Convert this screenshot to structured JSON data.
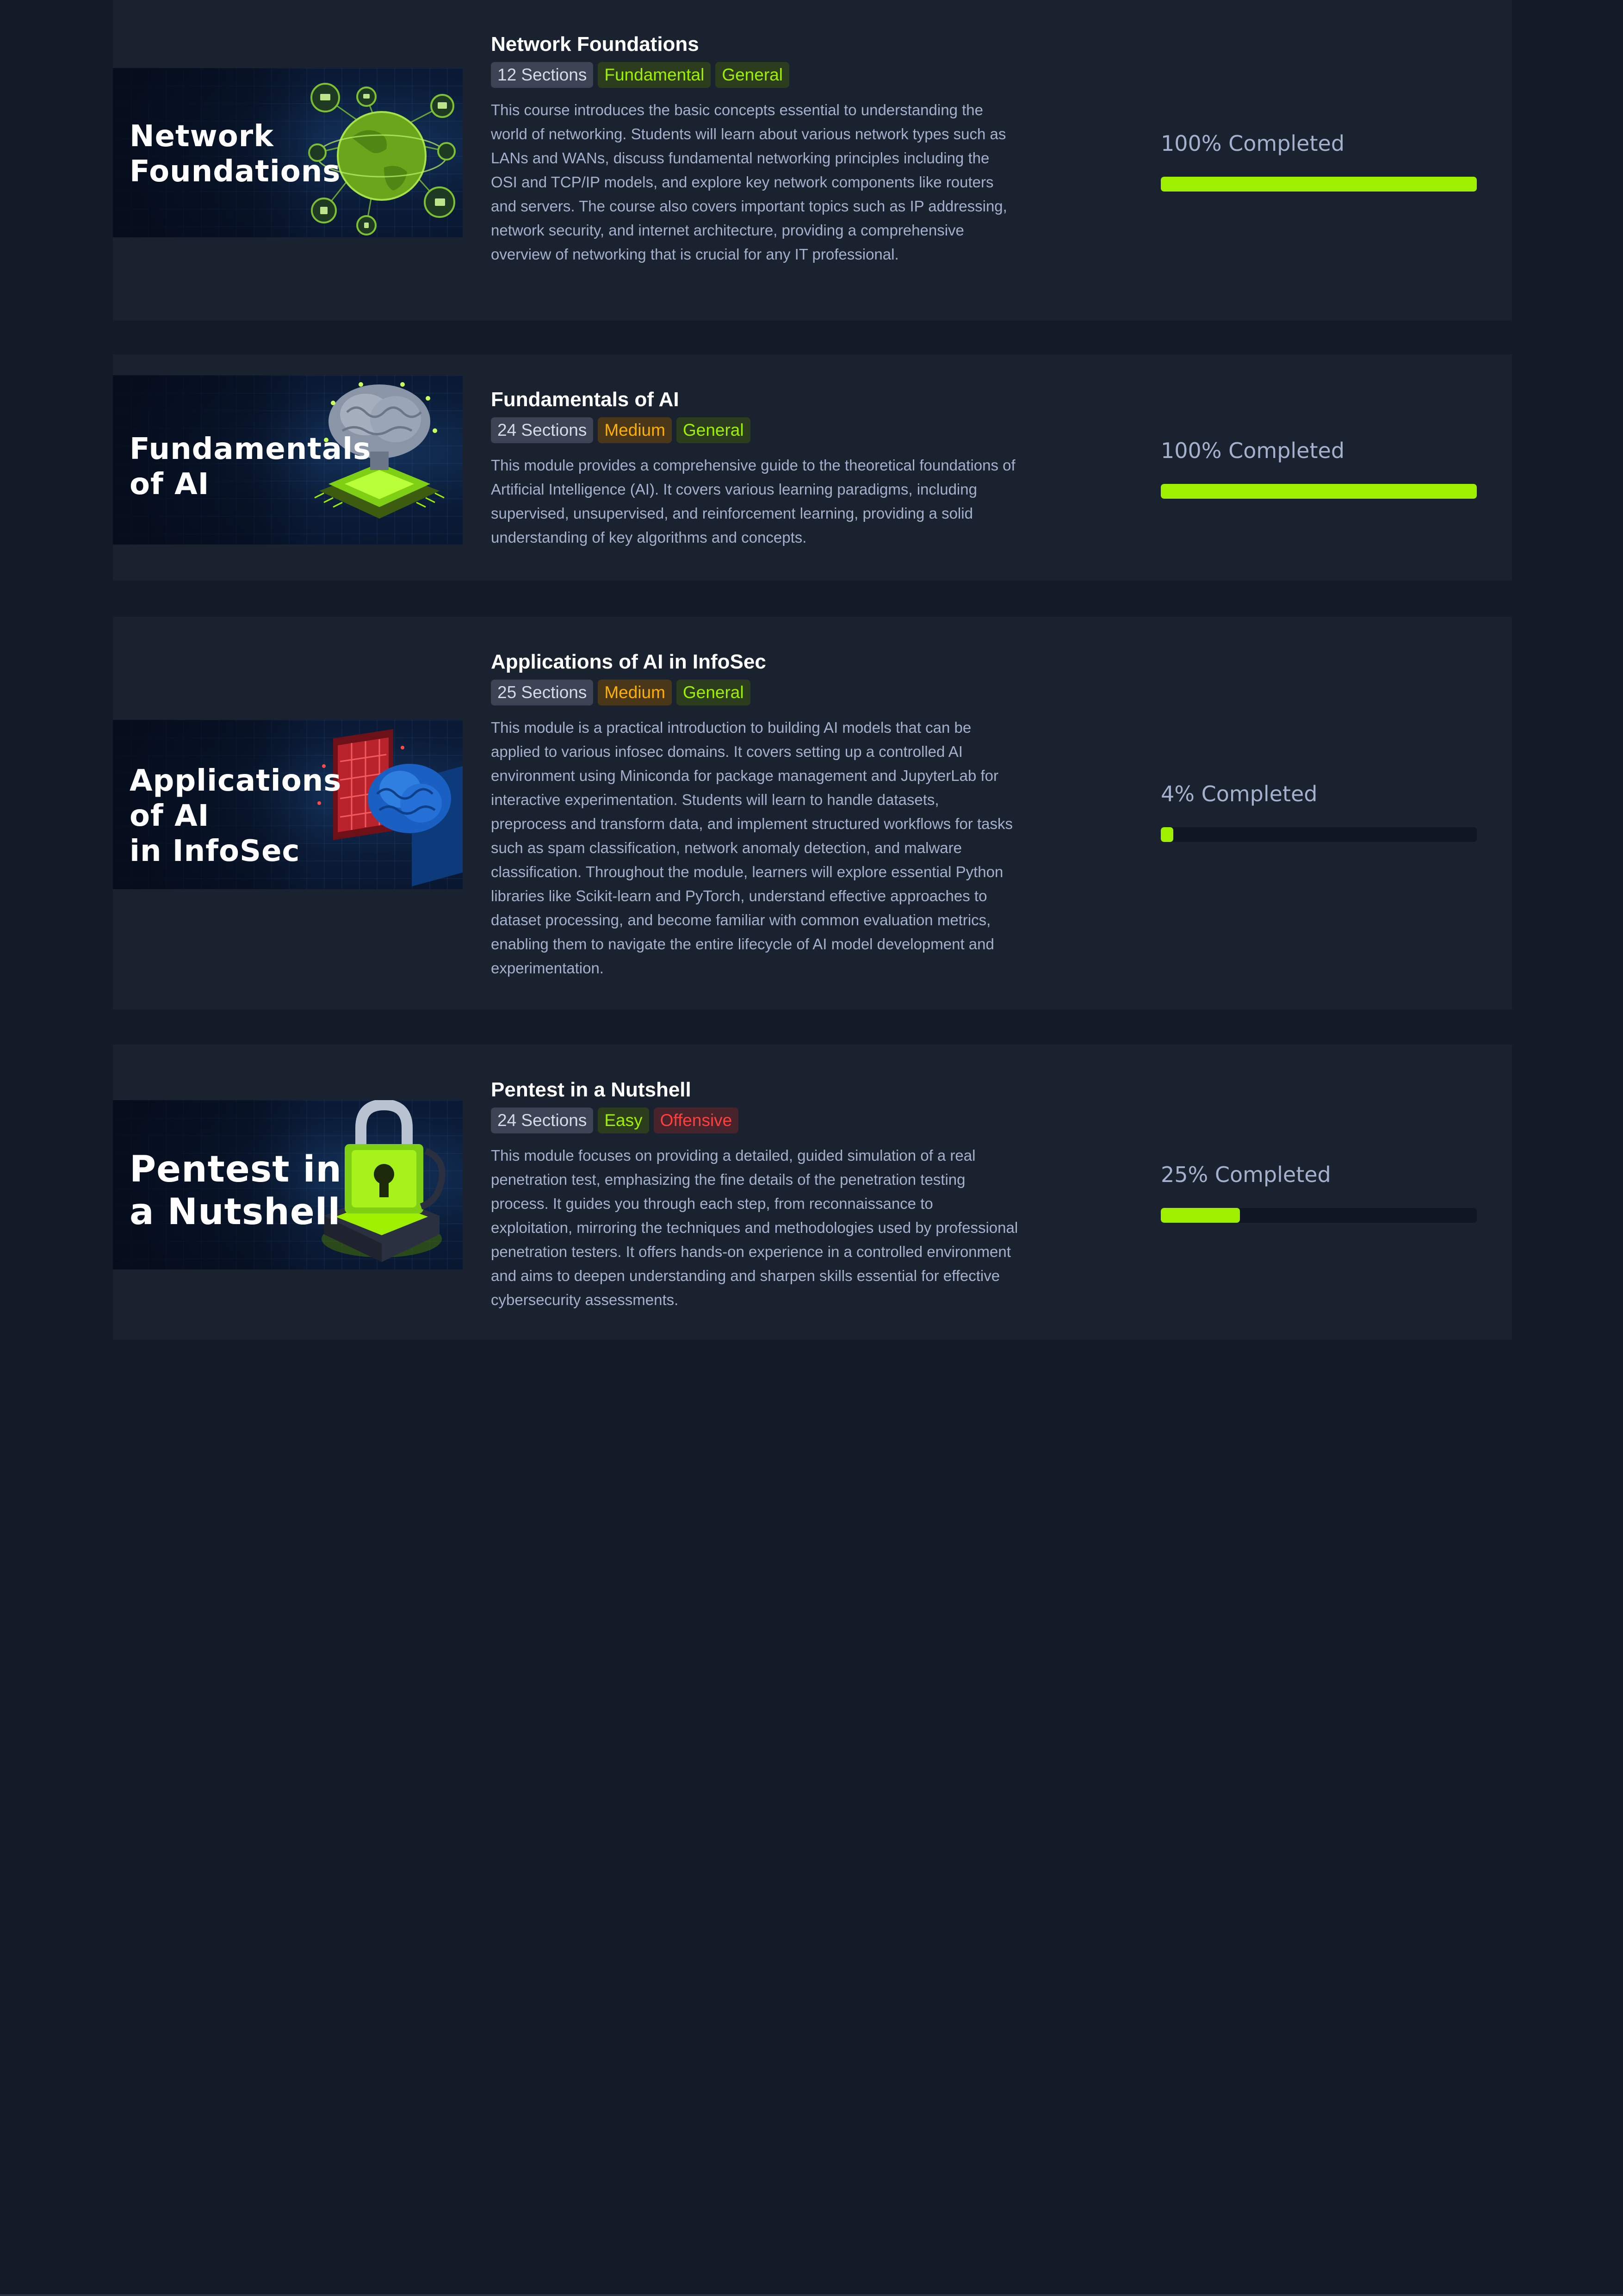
{
  "accent_color": "#9fef00",
  "courses": [
    {
      "thumbnail_title": "Network\nFoundations",
      "title": "Network Foundations",
      "tags": [
        "12 Sections",
        "Fundamental",
        "General"
      ],
      "description": "This course introduces the basic concepts essential to understanding the world of networking. Students will learn about various network types such as LANs and WANs, discuss fundamental networking principles including the OSI and TCP/IP models, and explore key network components like routers and servers. The course also covers important topics such as IP addressing, network security, and internet architecture, providing a comprehensive overview of networking that is crucial for any IT professional.",
      "progress_label": "100% Completed",
      "progress_value": 100
    },
    {
      "thumbnail_title": "Fundamentals\nof AI",
      "title": "Fundamentals of AI",
      "tags": [
        "24 Sections",
        "Medium",
        "General"
      ],
      "description": "This module provides a comprehensive guide to the theoretical foundations of Artificial Intelligence (AI). It covers various learning paradigms, including supervised, unsupervised, and reinforcement learning, providing a solid understanding of key algorithms and concepts.",
      "progress_label": "100% Completed",
      "progress_value": 100
    },
    {
      "thumbnail_title": "Applications\nof AI\nin InfoSec",
      "title": "Applications of AI in InfoSec",
      "tags": [
        "25 Sections",
        "Medium",
        "General"
      ],
      "description": "This module is a practical introduction to building AI models that can be applied to various infosec domains. It covers setting up a controlled AI environment using Miniconda for package management and JupyterLab for interactive experimentation. Students will learn to handle datasets, preprocess and transform data, and implement structured workflows for tasks such as spam classification, network anomaly detection, and malware classification. Throughout the module, learners will explore essential Python libraries like Scikit-learn and PyTorch, understand effective approaches to dataset processing, and become familiar with common evaluation metrics, enabling them to navigate the entire lifecycle of AI model development and experimentation.",
      "progress_label": "4% Completed",
      "progress_value": 4
    },
    {
      "thumbnail_title": "Pentest in\na Nutshell",
      "title": "Pentest in a Nutshell",
      "tags": [
        "24 Sections",
        "Easy",
        "Offensive"
      ],
      "description": "This module focuses on providing a detailed, guided simulation of a real penetration test, emphasizing the fine details of the penetration testing process. It guides you through each step, from reconnaissance to exploitation, mirroring the techniques and methodologies used by professional penetration testers. It offers hands-on experience in a controlled environment and aims to deepen understanding and sharpen skills essential for effective cybersecurity assessments.",
      "progress_label": "25% Completed",
      "progress_value": 25
    }
  ]
}
